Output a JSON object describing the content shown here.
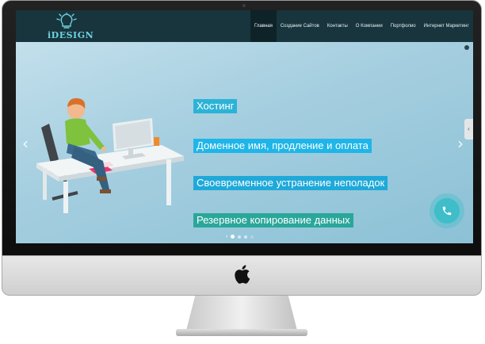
{
  "brand": {
    "logo_text": "iDESIGN",
    "accent": "#6fd3df"
  },
  "nav": {
    "items": [
      "Главная",
      "Создание Сайтов",
      "Контакты",
      "О Компании",
      "Портфолио",
      "Интернет Маркетинг"
    ],
    "active_index": 0
  },
  "slider": {
    "features": [
      "Хостинг",
      "Доменное имя, продление и оплата",
      "Своевременное устранение неполадок",
      "Резервное копирование данных"
    ],
    "prev_arrow": "‹",
    "next_arrow": "›",
    "pager_prev": "‹",
    "page_count": 4,
    "active_page": 1
  },
  "side_tab": {
    "label": "‹"
  },
  "call_button": {
    "icon": "phone-icon",
    "color": "#3fbdc9"
  },
  "colors": {
    "navbar": "#18353d",
    "hostinger_badge": "#2bb3d6",
    "backup_badge": "#2aa79a"
  }
}
